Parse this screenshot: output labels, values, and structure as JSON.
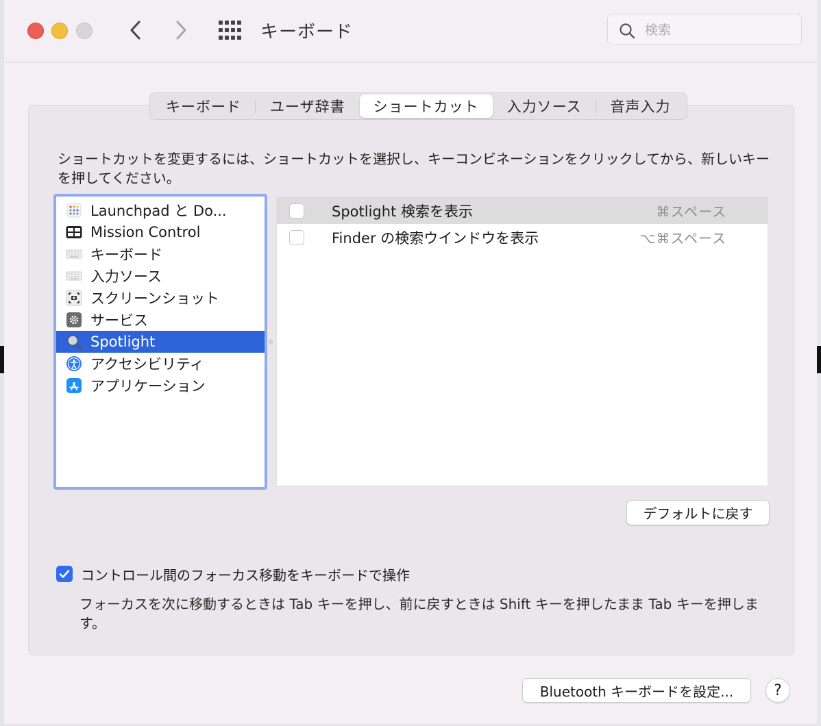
{
  "window": {
    "title": "キーボード"
  },
  "search": {
    "placeholder": "検索"
  },
  "tabs": [
    {
      "label": "キーボード"
    },
    {
      "label": "ユーザ辞書"
    },
    {
      "label": "ショートカット"
    },
    {
      "label": "入力ソース"
    },
    {
      "label": "音声入力"
    }
  ],
  "active_tab": "ショートカット",
  "instructions": "ショートカットを変更するには、ショートカットを選択し、キーコンビネーションをクリックしてから、新しいキーを押してください。",
  "categories": [
    {
      "label": "Launchpad と Do...",
      "icon": "launchpad-icon"
    },
    {
      "label": "Mission Control",
      "icon": "mission-control-icon"
    },
    {
      "label": "キーボード",
      "icon": "keyboard-icon"
    },
    {
      "label": "入力ソース",
      "icon": "input-source-icon"
    },
    {
      "label": "スクリーンショット",
      "icon": "screenshot-icon"
    },
    {
      "label": "サービス",
      "icon": "gear-icon"
    },
    {
      "label": "Spotlight",
      "icon": "magnifier-icon"
    },
    {
      "label": "アクセシビリティ",
      "icon": "accessibility-icon"
    },
    {
      "label": "アプリケーション",
      "icon": "app-store-icon"
    }
  ],
  "selected_category": "Spotlight",
  "shortcuts": [
    {
      "name": "Spotlight 検索を表示",
      "key": "⌘スペース",
      "checked": false
    },
    {
      "name": "Finder の検索ウインドウを表示",
      "key": "⌥⌘スペース",
      "checked": false
    }
  ],
  "buttons": {
    "restore_defaults": "デフォルトに戻す",
    "bluetooth": "Bluetooth キーボードを設定...",
    "help": "?"
  },
  "keyboard_nav": {
    "label": "コントロール間のフォーカス移動をキーボードで操作",
    "checked": true,
    "note": "フォーカスを次に移動するときは Tab キーを押し、前に戻すときは Shift キーを押したまま Tab キーを押します。"
  },
  "colors": {
    "accent": "#2e63d9",
    "selection_ring": "#8eabee",
    "close": "#ec5f57",
    "minimize": "#f3bd3d",
    "zoom": "#d8d4d8"
  }
}
